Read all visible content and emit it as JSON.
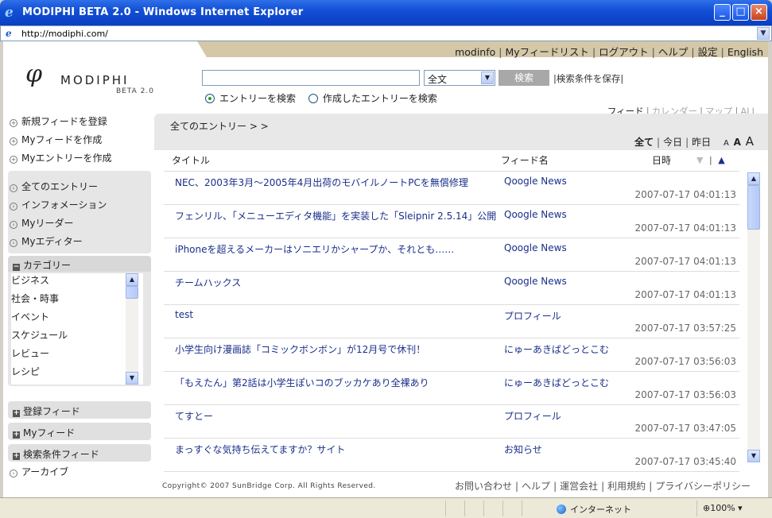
{
  "window": {
    "title": "MODIPHI BETA 2.0 - Windows Internet Explorer",
    "url": "http://modiphi.com/"
  },
  "topnav": [
    "modinfo",
    "Myフィードリスト",
    "ログアウト",
    "ヘルプ",
    "設定",
    "English"
  ],
  "logo": {
    "wordmark": "MODIPHI",
    "version": "BETA 2.0"
  },
  "search": {
    "value": "",
    "scope": "全文",
    "button": "検索",
    "save_label": "|検索条件を保存|",
    "radio_entries": "エントリーを検索",
    "radio_created": "作成したエントリーを検索"
  },
  "viewtabs": {
    "feed": "フィード",
    "calendar": "カレンダー",
    "map": "マップ",
    "all": "ALL"
  },
  "sidebar": {
    "actions": [
      "新規フィードを登録",
      "Myフィードを作成",
      "Myエントリーを作成"
    ],
    "nav": [
      "全てのエントリー",
      "インフォメーション",
      "Myリーダー",
      "Myエディター"
    ],
    "category_title": "カテゴリー",
    "categories": [
      "ビジネス",
      "社会・時事",
      "イベント",
      "スケジュール",
      "レビュー",
      "レシピ"
    ],
    "registered_feeds": "登録フィード",
    "my_feeds": "Myフィード",
    "search_feeds": "検索条件フィード",
    "archive": "アーカイブ"
  },
  "main": {
    "breadcrumb": "全てのエントリー > >",
    "filters": {
      "all": "全て",
      "today": "今日",
      "yesterday": "昨日"
    },
    "fontsizes": {
      "small": "A",
      "medium": "A",
      "large": "A"
    },
    "columns": {
      "title": "タイトル",
      "feed": "フィード名",
      "date": "日時"
    },
    "sort_desc": "▼",
    "sort_asc": "▲",
    "rows": [
      {
        "title": "NEC、2003年3月～2005年4月出荷のモバイルノートPCを無償修理",
        "feed": "Qoogle News",
        "date": "2007-07-17 04:01:13"
      },
      {
        "title": "フェンリル、「メニューエディタ機能」を実装した「Sleipnir 2.5.14」公開",
        "feed": "Qoogle News",
        "date": "2007-07-17 04:01:13"
      },
      {
        "title": "iPhoneを超えるメーカーはソニエリかシャープか、それとも……",
        "feed": "Qoogle News",
        "date": "2007-07-17 04:01:13"
      },
      {
        "title": "チームハックス",
        "feed": "Qoogle News",
        "date": "2007-07-17 04:01:13"
      },
      {
        "title": "test",
        "feed": "プロフィール",
        "date": "2007-07-17 03:57:25"
      },
      {
        "title": "小学生向け漫画誌「コミックボンボン」が12月号で休刊！",
        "feed": "にゅーあきばどっとこむ",
        "date": "2007-07-17 03:56:03"
      },
      {
        "title": "「もえたん」第2話は小学生ぽいコのブッカケあり全裸あり",
        "feed": "にゅーあきばどっとこむ",
        "date": "2007-07-17 03:56:03"
      },
      {
        "title": "てすとー",
        "feed": "プロフィール",
        "date": "2007-07-17 03:47:05"
      },
      {
        "title": "まっすぐな気持ち伝えてますか？サイト",
        "feed": "お知らせ",
        "date": "2007-07-17 03:45:40"
      }
    ]
  },
  "footer": {
    "copyright": "Copyright© 2007 SunBridge Corp. All Rights Reserved.",
    "links": [
      "お問い合わせ",
      "ヘルプ",
      "運営会社",
      "利用規約",
      "プライバシーポリシー"
    ]
  },
  "statusbar": {
    "zone": "インターネット",
    "zoom": "100%"
  }
}
